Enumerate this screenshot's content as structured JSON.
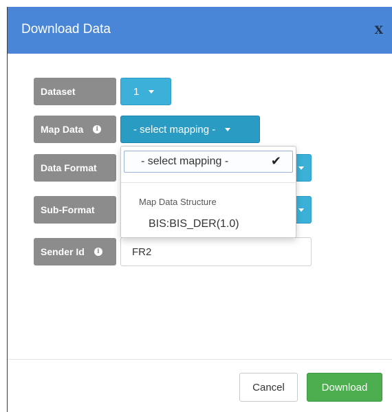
{
  "dialog": {
    "title": "Download Data",
    "close_label": "X"
  },
  "form": {
    "dataset_label": "Dataset",
    "dataset_value": "1",
    "map_data_label": "Map Data",
    "map_data_value": "- select mapping -",
    "data_format_label": "Data Format",
    "sub_format_label": "Sub-Format",
    "sender_id_label": "Sender Id",
    "sender_id_value": "FR2"
  },
  "dropdown": {
    "selected": "- select mapping -",
    "check_glyph": "✔",
    "group_header": "Map Data Structure",
    "items": [
      "BIS:BIS_DER(1.0)"
    ]
  },
  "footer": {
    "cancel_label": "Cancel",
    "download_label": "Download"
  },
  "colors": {
    "header_bg": "#4a86d8",
    "info_button": "#3cb0d8",
    "download_button": "#4cae4f",
    "label_bg": "#8c8c8c"
  },
  "icons": {
    "info": "info-circle-icon",
    "caret": "caret-down-icon",
    "check": "check-icon"
  }
}
